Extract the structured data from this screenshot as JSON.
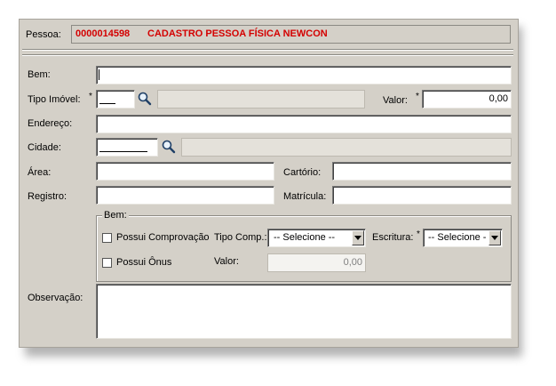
{
  "header": {
    "pessoa_label": "Pessoa:",
    "pessoa_code": "0000014598",
    "pessoa_name": "CADASTRO PESSOA FÍSICA NEWCON"
  },
  "form": {
    "bem_label": "Bem:",
    "bem_value": "",
    "tipo_imovel_label": "Tipo Imóvel:",
    "tipo_imovel_required": "*",
    "tipo_imovel_code": "",
    "tipo_imovel_desc": "",
    "valor_label": "Valor:",
    "valor_required": "*",
    "valor_value": "0,00",
    "endereco_label": "Endereço:",
    "endereco_value": "",
    "cidade_label": "Cidade:",
    "cidade_code": "",
    "cidade_desc": "",
    "area_label": "Área:",
    "area_value": "",
    "cartorio_label": "Cartório:",
    "cartorio_value": "",
    "registro_label": "Registro:",
    "registro_value": "",
    "matricula_label": "Matrícula:",
    "matricula_value": "",
    "observacao_label": "Observação:",
    "observacao_value": ""
  },
  "bem_group": {
    "title": "Bem:",
    "possui_comprovacao_label": "Possui Comprovação",
    "possui_comprovacao_checked": false,
    "tipo_comp_label": "Tipo Comp.:",
    "tipo_comp_selected": "-- Selecione --",
    "escritura_label": "Escritura:",
    "escritura_required": "*",
    "escritura_selected": "-- Selecione -",
    "possui_onus_label": "Possui Ônus",
    "possui_onus_checked": false,
    "valor_label": "Valor:",
    "valor_value": "0,00"
  },
  "icons": {
    "search": "magnifier-icon",
    "dropdown": "chevron-down-icon"
  }
}
